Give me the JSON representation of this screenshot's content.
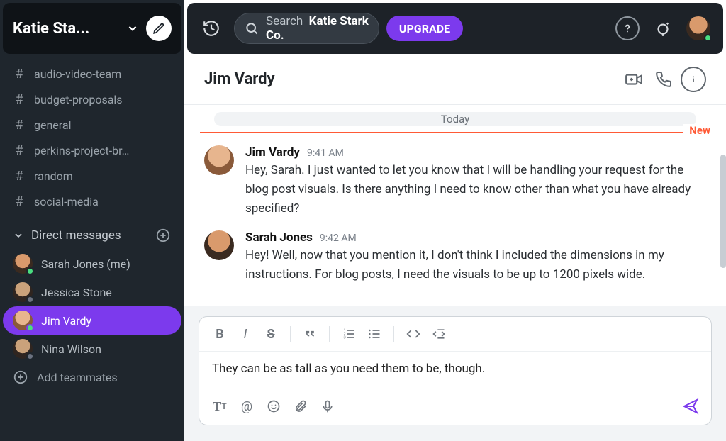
{
  "workspace": {
    "name": "Katie Sta..."
  },
  "search": {
    "prefix": "Search",
    "value": "Katie Stark Co."
  },
  "upgrade_label": "UPGRADE",
  "channels": [
    {
      "name": "audio-video-team"
    },
    {
      "name": "budget-proposals"
    },
    {
      "name": "general"
    },
    {
      "name": "perkins-project-br…"
    },
    {
      "name": "random"
    },
    {
      "name": "social-media"
    }
  ],
  "dm_section_title": "Direct messages",
  "dms": [
    {
      "name": "Sarah Jones (me)",
      "presence": "online",
      "face": "f2",
      "active": false
    },
    {
      "name": "Jessica Stone",
      "presence": "offline",
      "face": "f4",
      "active": false
    },
    {
      "name": "Jim Vardy",
      "presence": "online",
      "face": "f3",
      "active": true
    },
    {
      "name": "Nina Wilson",
      "presence": "offline",
      "face": "f4",
      "active": false
    }
  ],
  "add_teammates_label": "Add teammates",
  "conversation": {
    "title": "Jim Vardy",
    "day_label": "Today",
    "new_label": "New",
    "messages": [
      {
        "author": "Jim Vardy",
        "time": "9:41 AM",
        "face": "f3",
        "text": "Hey, Sarah. I just wanted to let you know that I will be handling your request for the blog post visuals. Is there anything I need to know other than what you have already specified?"
      },
      {
        "author": "Sarah Jones",
        "time": "9:42 AM",
        "face": "f2",
        "text": "Hey! Well, now that you mention it, I don't think I included the dimensions in my instructions. For blog posts, I need the visuals to be up to 1200 pixels wide."
      }
    ]
  },
  "composer": {
    "text": "They can be as tall as you need them to be, though."
  },
  "colors": {
    "accent": "#7c3aed"
  }
}
